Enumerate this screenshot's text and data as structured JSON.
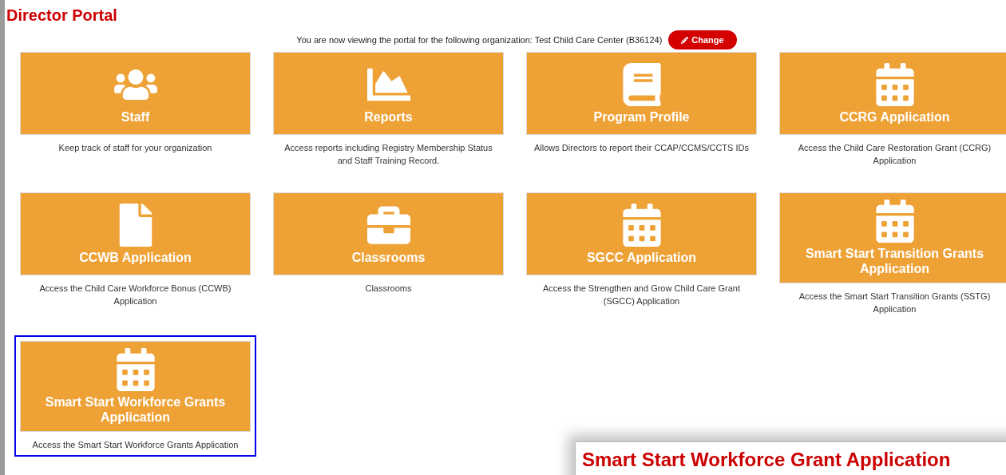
{
  "page_title": "Director Portal",
  "organization_notice": "You are now viewing the portal for the following organization: Test Child Care Center (B36124)",
  "change_button": "Change",
  "tiles": [
    {
      "kind": "users",
      "title": "Staff",
      "description": "Keep track of staff for your organization",
      "selected": false
    },
    {
      "kind": "chart",
      "title": "Reports",
      "description": "Access reports including Registry Membership Status and Staff Training Record.",
      "selected": false
    },
    {
      "kind": "book",
      "title": "Program Profile",
      "description": "Allows Directors to report their CCAP/CCMS/CCTS IDs",
      "selected": false
    },
    {
      "kind": "calendar",
      "title": "CCRG Application",
      "description": "Access the Child Care Restoration Grant (CCRG) Application",
      "selected": false
    },
    {
      "kind": "file",
      "title": "CCWB Application",
      "description": "Access the Child Care Workforce Bonus (CCWB) Application",
      "selected": false
    },
    {
      "kind": "briefcase",
      "title": "Classrooms",
      "description": "Classrooms",
      "selected": false
    },
    {
      "kind": "calendar",
      "title": "SGCC Application",
      "description": "Access the Strengthen and Grow Child Care Grant (SGCC) Application",
      "selected": false
    },
    {
      "kind": "calendar",
      "title": "Smart Start Transition Grants Application",
      "description": "Access the Smart Start Transition Grants (SSTG) Application",
      "selected": false
    },
    {
      "kind": "calendar",
      "title": "Smart Start Workforce Grants Application",
      "description": "Access the Smart Start Workforce Grants Application",
      "selected": true
    }
  ],
  "overlay_window": {
    "title": "Smart Start Workforce Grant Application"
  }
}
